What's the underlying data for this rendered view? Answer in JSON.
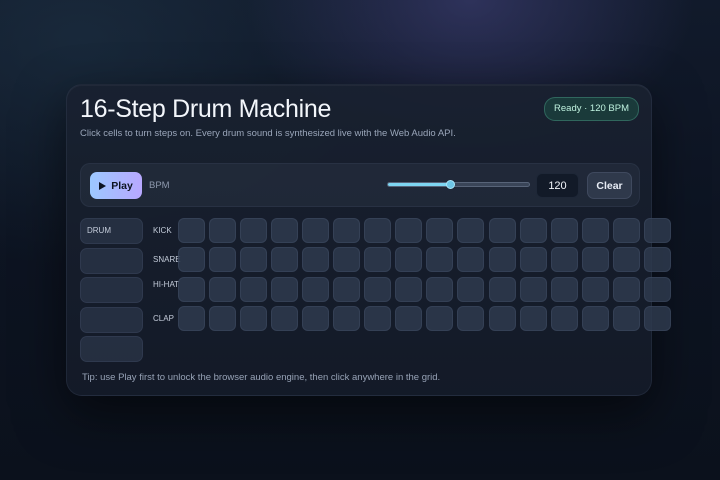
{
  "header": {
    "title": "16-Step Drum Machine",
    "subtitle": "Click cells to turn steps on. Every drum sound is synthesized live with the Web Audio API.",
    "status": "Ready · 120 BPM"
  },
  "toolbar": {
    "play_label": "Play",
    "bpm_label": "BPM",
    "bpm_value": "120",
    "bpm_slider_fraction": 0.44,
    "clear_label": "Clear"
  },
  "sidebar": {
    "header_label": "DRUM",
    "empty_pads": 4
  },
  "tracks": [
    {
      "name": "KICK",
      "steps": [
        0,
        0,
        0,
        0,
        0,
        0,
        0,
        0,
        0,
        0,
        0,
        0,
        0,
        0,
        0,
        0
      ]
    },
    {
      "name": "SNARE",
      "steps": [
        0,
        0,
        0,
        0,
        0,
        0,
        0,
        0,
        0,
        0,
        0,
        0,
        0,
        0,
        0,
        0
      ]
    },
    {
      "name": "HI-HAT",
      "steps": [
        0,
        0,
        0,
        0,
        0,
        0,
        0,
        0,
        0,
        0,
        0,
        0,
        0,
        0,
        0,
        0
      ]
    },
    {
      "name": "CLAP",
      "steps": [
        0,
        0,
        0,
        0,
        0,
        0,
        0,
        0,
        0,
        0,
        0,
        0,
        0,
        0,
        0,
        0
      ]
    }
  ],
  "tip": "Tip: use Play first to unlock the browser audio engine, then click anywhere in the grid.",
  "colors": {
    "accent_start": "#9cc8ff",
    "accent_end": "#b8a8ff",
    "slider_fill": "#7ed6f2",
    "status_text": "#bff2df"
  }
}
